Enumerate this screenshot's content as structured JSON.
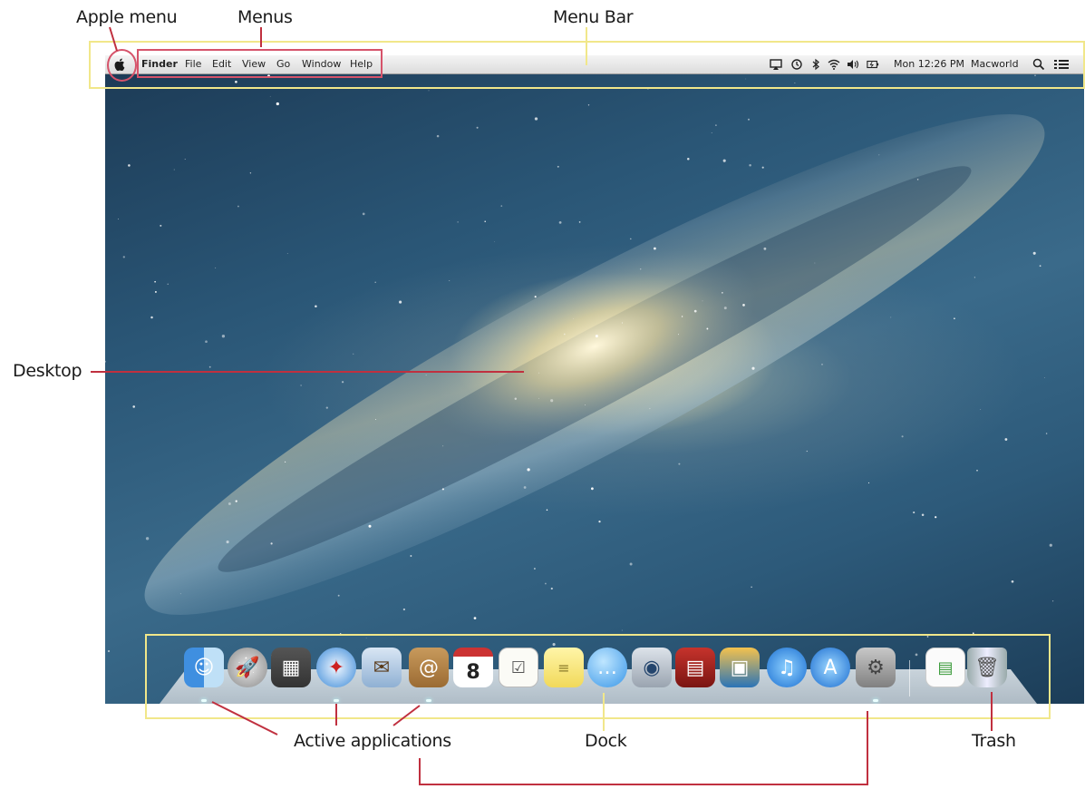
{
  "annotations": {
    "apple_menu": "Apple menu",
    "menus": "Menus",
    "menu_bar": "Menu Bar",
    "desktop": "Desktop",
    "active_applications": "Active applications",
    "dock": "Dock",
    "trash": "Trash"
  },
  "menubar": {
    "apple_icon": "apple-logo-icon",
    "items": [
      "Finder",
      "File",
      "Edit",
      "View",
      "Go",
      "Window",
      "Help"
    ],
    "clock": "Mon 12:26 PM",
    "user": "Macworld",
    "status_icons": [
      "airplay-icon",
      "time-machine-icon",
      "bluetooth-icon",
      "wifi-icon",
      "volume-icon",
      "battery-icon",
      "search-icon",
      "list-icon"
    ]
  },
  "calendar_date": "8",
  "colors": {
    "annotation_yellow": "#f1e78a",
    "annotation_red": "#d6536a",
    "leader_line": "#c0303f"
  },
  "dock": {
    "apps": [
      {
        "icon": "finder-icon",
        "running": true
      },
      {
        "icon": "launchpad-icon",
        "running": false
      },
      {
        "icon": "mission-control-icon",
        "running": false
      },
      {
        "icon": "safari-icon",
        "running": true
      },
      {
        "icon": "mail-icon",
        "running": false
      },
      {
        "icon": "contacts-icon",
        "running": true
      },
      {
        "icon": "calendar-icon",
        "running": false
      },
      {
        "icon": "reminders-icon",
        "running": false
      },
      {
        "icon": "notes-icon",
        "running": false
      },
      {
        "icon": "messages-icon",
        "running": false
      },
      {
        "icon": "facetime-icon",
        "running": false
      },
      {
        "icon": "photo-booth-icon",
        "running": false
      },
      {
        "icon": "iphoto-icon",
        "running": false
      },
      {
        "icon": "itunes-icon",
        "running": false
      },
      {
        "icon": "app-store-icon",
        "running": false
      },
      {
        "icon": "system-preferences-icon",
        "running": true
      }
    ],
    "documents": [
      {
        "icon": "document-stack-icon"
      },
      {
        "icon": "trash-icon"
      }
    ]
  }
}
